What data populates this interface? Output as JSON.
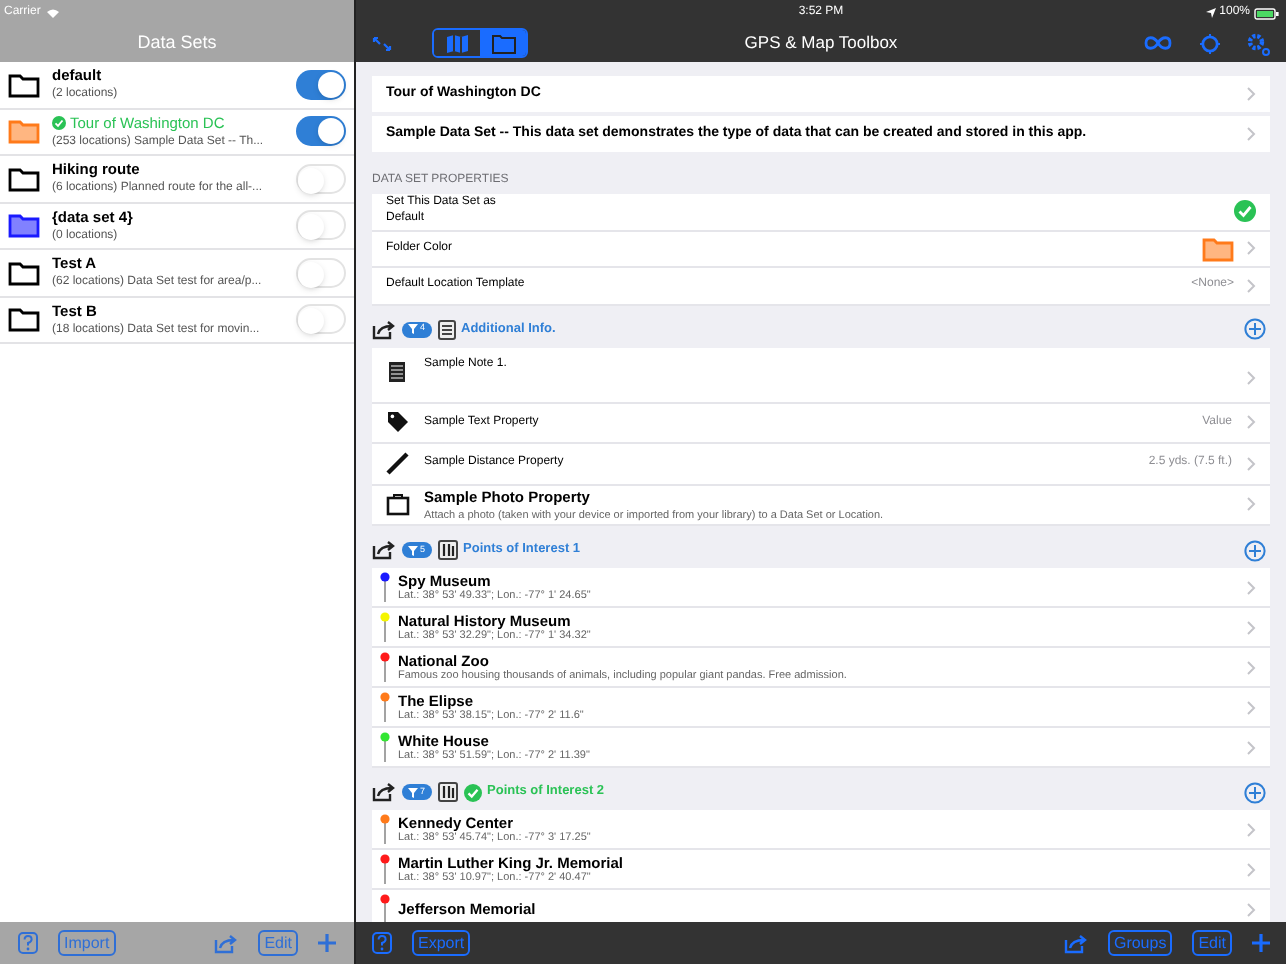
{
  "status_bar": {
    "carrier": "Carrier",
    "time": "3:52 PM",
    "battery": "100%"
  },
  "left": {
    "title": "Data Sets",
    "data_sets": [
      {
        "name": "default",
        "detail": "(2 locations)",
        "color": "#000000",
        "on": true,
        "default": false
      },
      {
        "name": "Tour of Washington DC",
        "detail": "(253 locations) Sample Data Set -- Th...",
        "color": "#ff7a1a",
        "on": true,
        "default": true
      },
      {
        "name": "Hiking route",
        "detail": "(6 locations) Planned route for the all-...",
        "color": "#000000",
        "on": false,
        "default": false
      },
      {
        "name": "{data set 4}",
        "detail": "(0 locations)",
        "color": "#1a1aff",
        "on": false,
        "default": false
      },
      {
        "name": "Test A",
        "detail": "(62 locations) Data Set test for area/p...",
        "color": "#000000",
        "on": false,
        "default": false
      },
      {
        "name": "Test B",
        "detail": "(18 locations) Data Set test for movin...",
        "color": "#000000",
        "on": false,
        "default": false
      }
    ],
    "toolbar": {
      "import": "Import",
      "edit": "Edit"
    }
  },
  "right": {
    "title": "GPS & Map Toolbox",
    "view_tabs": [
      {
        "kind": "map",
        "selected": false
      },
      {
        "kind": "folder",
        "selected": true
      }
    ],
    "header_rows": [
      "Tour of Washington DC",
      "Sample Data Set -- This data set demonstrates the type of data that can be created and stored in this app."
    ],
    "properties": {
      "heading": "DATA SET PROPERTIES",
      "rows": [
        {
          "kind": "check",
          "label": "Set This Data Set as Default",
          "checked": true
        },
        {
          "kind": "folder",
          "label": "Folder Color",
          "color": "#ff7a1a"
        },
        {
          "kind": "value",
          "label": "Default Location Template",
          "value": "<None>"
        }
      ]
    },
    "info_section": {
      "title": "Additional Info.",
      "badge": "4",
      "items": [
        {
          "kind": "note",
          "label": "Sample Note 1."
        },
        {
          "kind": "tag",
          "label": "Sample Text Property",
          "value": "Value"
        },
        {
          "kind": "ruler",
          "label": "Sample Distance Property",
          "value": "2.5 yds. (7.5 ft.)"
        },
        {
          "kind": "photo",
          "label": "Sample Photo Property",
          "detail": "Attach a photo (taken with your device or imported from your library) to a Data Set or Location."
        }
      ]
    },
    "groups": [
      {
        "title": "Points of Interest 1",
        "badge": "5",
        "default": false,
        "locations": [
          {
            "name": "Spy Museum",
            "detail": "Lat.: 38° 53' 49.33\"; Lon.: -77° 1' 24.65\"",
            "color": "#1a1aff"
          },
          {
            "name": "Natural History Museum",
            "detail": "Lat.: 38° 53' 32.29\"; Lon.: -77° 1' 34.32\"",
            "color": "#f5f500"
          },
          {
            "name": "National Zoo",
            "detail": "Famous zoo housing thousands of animals, including popular giant pandas. Free admission.",
            "color": "#ff1a1a"
          },
          {
            "name": "The Elipse",
            "detail": "Lat.: 38° 53' 38.15\"; Lon.: -77° 2' 11.6\"",
            "color": "#ff7a1a"
          },
          {
            "name": "White House",
            "detail": "Lat.: 38° 53' 51.59\"; Lon.: -77° 2' 11.39\"",
            "color": "#33e633"
          }
        ]
      },
      {
        "title": "Points of Interest 2",
        "badge": "7",
        "default": true,
        "locations": [
          {
            "name": "Kennedy Center",
            "detail": "Lat.: 38° 53' 45.74\"; Lon.: -77° 3' 17.25\"",
            "color": "#ff7a1a"
          },
          {
            "name": "Martin Luther King Jr. Memorial",
            "detail": "Lat.: 38° 53' 10.97\"; Lon.: -77° 2' 40.47\"",
            "color": "#ff1a1a"
          },
          {
            "name": "Jefferson Memorial",
            "color": "#ff1a1a"
          }
        ]
      }
    ],
    "toolbar": {
      "export": "Export",
      "groups": "Groups",
      "edit": "Edit"
    }
  }
}
